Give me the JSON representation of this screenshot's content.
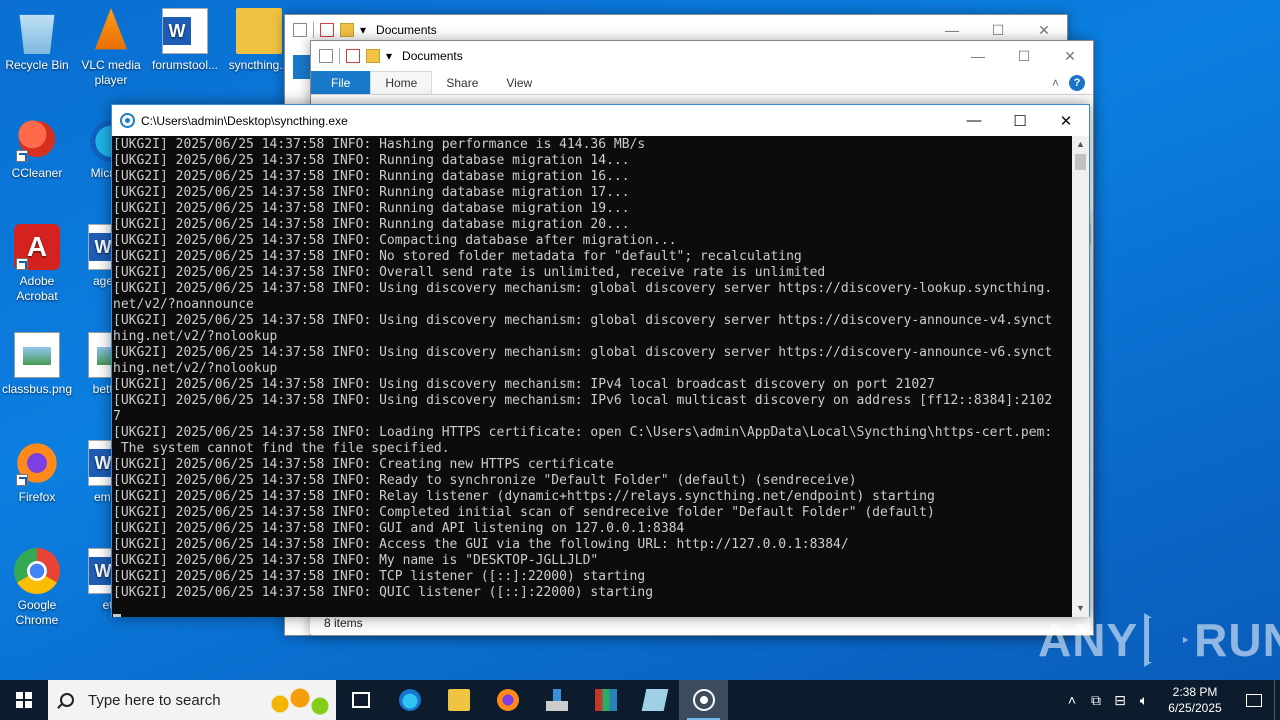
{
  "desktop": {
    "icons": [
      {
        "label": "Recycle Bin"
      },
      {
        "label": "VLC media player"
      },
      {
        "label": "forumstool..."
      },
      {
        "label": "syncthing..."
      },
      {
        "label": "CCleaner"
      },
      {
        "label": "Micr Ed"
      },
      {
        "label": "Adobe Acrobat"
      },
      {
        "label": "agents"
      },
      {
        "label": "classbus.png"
      },
      {
        "label": "betters"
      },
      {
        "label": "Firefox"
      },
      {
        "label": "emerg"
      },
      {
        "label": "Google Chrome"
      },
      {
        "label": "eto"
      }
    ]
  },
  "explorer_back": {
    "title": "Documents"
  },
  "explorer_front": {
    "title": "Documents",
    "tabs": [
      "File",
      "Home",
      "Share",
      "View"
    ],
    "status": "8 items"
  },
  "console": {
    "title": "C:\\Users\\admin\\Desktop\\syncthing.exe",
    "lines": [
      "[UKG2I] 2025/06/25 14:37:58 INFO: Hashing performance is 414.36 MB/s",
      "[UKG2I] 2025/06/25 14:37:58 INFO: Running database migration 14...",
      "[UKG2I] 2025/06/25 14:37:58 INFO: Running database migration 16...",
      "[UKG2I] 2025/06/25 14:37:58 INFO: Running database migration 17...",
      "[UKG2I] 2025/06/25 14:37:58 INFO: Running database migration 19...",
      "[UKG2I] 2025/06/25 14:37:58 INFO: Running database migration 20...",
      "[UKG2I] 2025/06/25 14:37:58 INFO: Compacting database after migration...",
      "[UKG2I] 2025/06/25 14:37:58 INFO: No stored folder metadata for \"default\"; recalculating",
      "[UKG2I] 2025/06/25 14:37:58 INFO: Overall send rate is unlimited, receive rate is unlimited",
      "[UKG2I] 2025/06/25 14:37:58 INFO: Using discovery mechanism: global discovery server https://discovery-lookup.syncthing.",
      "net/v2/?noannounce",
      "[UKG2I] 2025/06/25 14:37:58 INFO: Using discovery mechanism: global discovery server https://discovery-announce-v4.synct",
      "hing.net/v2/?nolookup",
      "[UKG2I] 2025/06/25 14:37:58 INFO: Using discovery mechanism: global discovery server https://discovery-announce-v6.synct",
      "hing.net/v2/?nolookup",
      "[UKG2I] 2025/06/25 14:37:58 INFO: Using discovery mechanism: IPv4 local broadcast discovery on port 21027",
      "[UKG2I] 2025/06/25 14:37:58 INFO: Using discovery mechanism: IPv6 local multicast discovery on address [ff12::8384]:2102",
      "7",
      "[UKG2I] 2025/06/25 14:37:58 INFO: Loading HTTPS certificate: open C:\\Users\\admin\\AppData\\Local\\Syncthing\\https-cert.pem:",
      " The system cannot find the file specified.",
      "[UKG2I] 2025/06/25 14:37:58 INFO: Creating new HTTPS certificate",
      "[UKG2I] 2025/06/25 14:37:58 INFO: Ready to synchronize \"Default Folder\" (default) (sendreceive)",
      "[UKG2I] 2025/06/25 14:37:58 INFO: Relay listener (dynamic+https://relays.syncthing.net/endpoint) starting",
      "[UKG2I] 2025/06/25 14:37:58 INFO: Completed initial scan of sendreceive folder \"Default Folder\" (default)",
      "[UKG2I] 2025/06/25 14:37:58 INFO: GUI and API listening on 127.0.0.1:8384",
      "[UKG2I] 2025/06/25 14:37:58 INFO: Access the GUI via the following URL: http://127.0.0.1:8384/",
      "[UKG2I] 2025/06/25 14:37:58 INFO: My name is \"DESKTOP-JGLLJLD\"",
      "[UKG2I] 2025/06/25 14:37:58 INFO: TCP listener ([::]:22000) starting",
      "[UKG2I] 2025/06/25 14:37:58 INFO: QUIC listener ([::]:22000) starting"
    ]
  },
  "watermark": {
    "left": "ANY",
    "right": "RUN"
  },
  "taskbar": {
    "search_placeholder": "Type here to search",
    "time": "2:38 PM",
    "date": "6/25/2025"
  }
}
